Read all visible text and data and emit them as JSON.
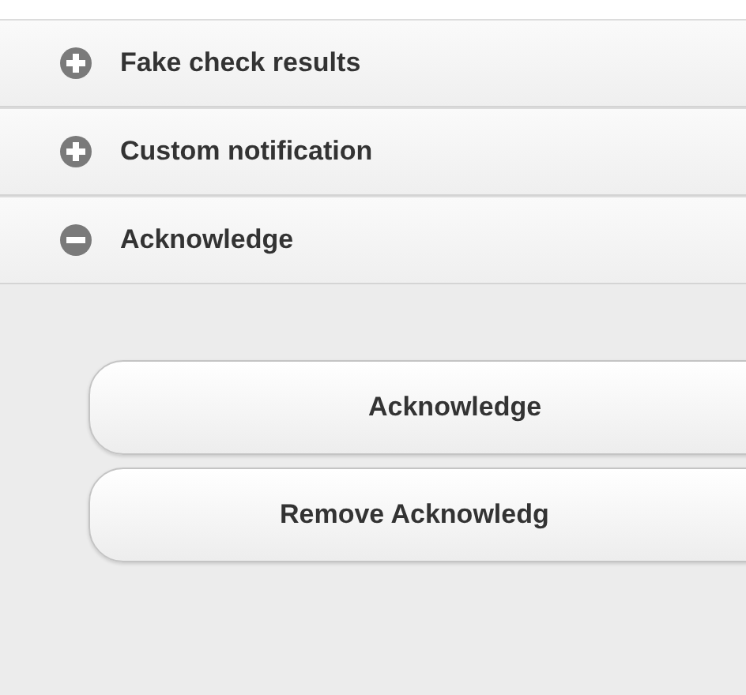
{
  "sections": [
    {
      "label": "Fake check results",
      "expanded": false
    },
    {
      "label": "Custom notification",
      "expanded": false
    },
    {
      "label": "Acknowledge",
      "expanded": true,
      "buttons": [
        "Acknowledge",
        "Remove Acknowledg"
      ]
    }
  ]
}
